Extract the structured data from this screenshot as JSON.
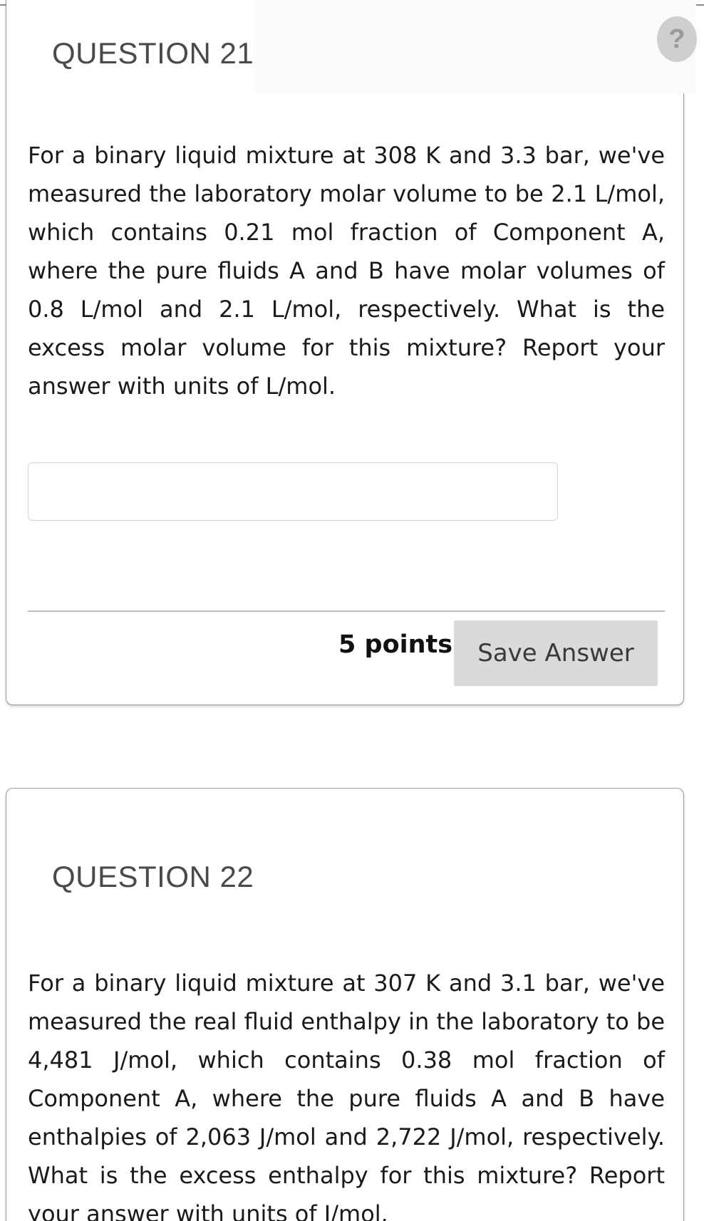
{
  "questions": [
    {
      "title": "QUESTION 21",
      "text": "For a binary liquid mixture at 308 K and 3.3 bar, we've measured the laboratory molar volume to be 2.1 L/mol, which contains 0.21 mol fraction of Component A, where the pure fluids A and B have molar volumes of 0.8 L/mol and 2.1 L/mol, respectively. What is the excess molar volume for this mixture? Report your answer with units of L/mol.",
      "answer_value": "",
      "points": "5 points",
      "save_label": "Save Answer",
      "help_glyph": "?"
    },
    {
      "title": "QUESTION 22",
      "text": "For a binary liquid mixture at 307 K and 3.1 bar, we've measured the real fluid enthalpy in the laboratory to be 4,481 J/mol, which contains 0.38 mol fraction of Component A, where the pure fluids A and B have enthalpies of 2,063 J/mol and 2,722 J/mol, respectively. What is the excess enthalpy for this mixture? Report your answer with units of J/mol."
    }
  ],
  "icons": {
    "help": "help-icon"
  },
  "colors": {
    "help_bg": "#cfcfcf",
    "button_bg": "#dadada",
    "border": "#9a9a9a"
  }
}
